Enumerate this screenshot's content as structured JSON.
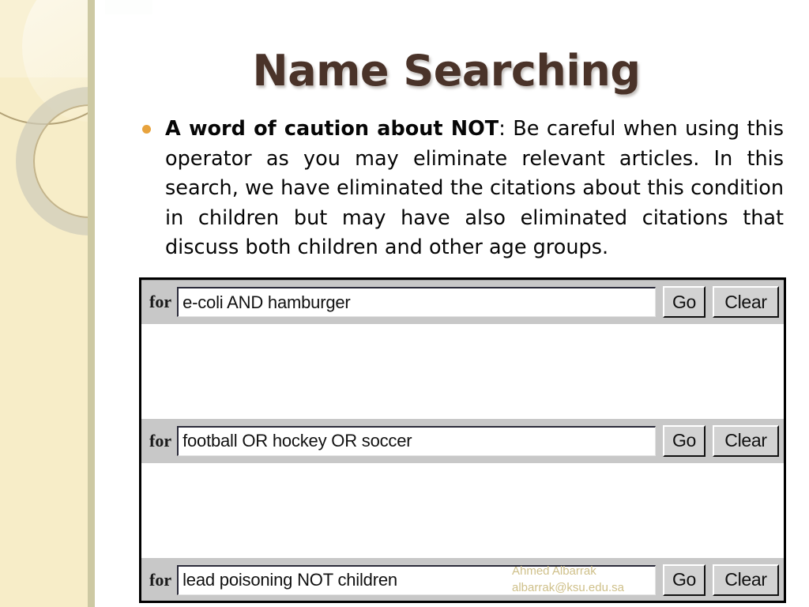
{
  "slide": {
    "title": "Name Searching",
    "bullet": {
      "bold_lead": "A word of caution about NOT",
      "rest": ": Be careful when using this operator as you may eliminate relevant articles. In this search, we have eliminated the citations about this condition in children but may have also eliminated citations that discuss both children and other age groups."
    }
  },
  "screenshot": {
    "search_bars": [
      {
        "for_label": "for",
        "query": "e-coli AND hamburger",
        "go_label": "Go",
        "clear_label": "Clear"
      },
      {
        "for_label": "for",
        "query": "football OR hockey OR soccer",
        "go_label": "Go",
        "clear_label": "Clear"
      },
      {
        "for_label": "for",
        "query": "lead poisoning NOT children",
        "go_label": "Go",
        "clear_label": "Clear"
      }
    ]
  },
  "watermark": {
    "name": "Ahmed Albarrak",
    "email": "albarrak@ksu.edu.sa"
  },
  "colors": {
    "sidebar_bg": "#f7edc8",
    "sidebar_stripe": "#cdc9a3",
    "title": "#4a3329",
    "bullet_dot": "#e8a33d",
    "watermark": "#cfc08a",
    "toolbar_bg": "#c8c8c8",
    "button_face": "#d2d2d2"
  }
}
